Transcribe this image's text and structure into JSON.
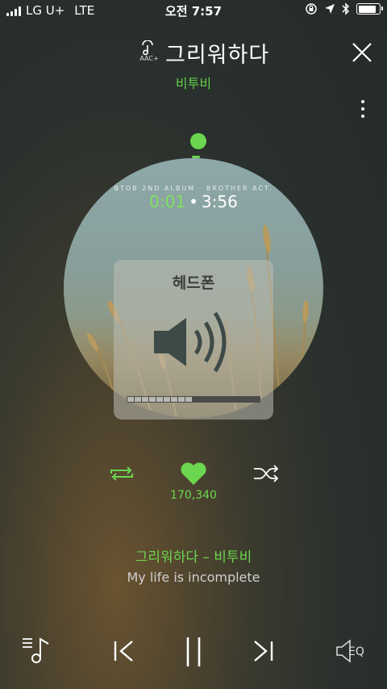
{
  "status_bar": {
    "carrier": "LG U+",
    "network": "LTE",
    "time": "오전 7:57",
    "battery_level": 0.85
  },
  "header": {
    "codec_label": "AAC+",
    "song_title": "그리워하다",
    "artist": "비투비"
  },
  "player": {
    "album_caption": "BTOB 2ND ALBUM · BROTHER ACT.",
    "current_time": "0:01",
    "separator": "•",
    "total_time": "3:56",
    "volume_overlay_label": "헤드폰",
    "volume_level_fraction": 0.5,
    "like_count": "170,340",
    "liked": true
  },
  "lyrics": {
    "title_line": "그리워하다 – 비투비",
    "current_line": "My life is incomplete"
  },
  "controls": {
    "eq_label": "EQ"
  },
  "colors": {
    "accent_green": "#6bd64f"
  }
}
